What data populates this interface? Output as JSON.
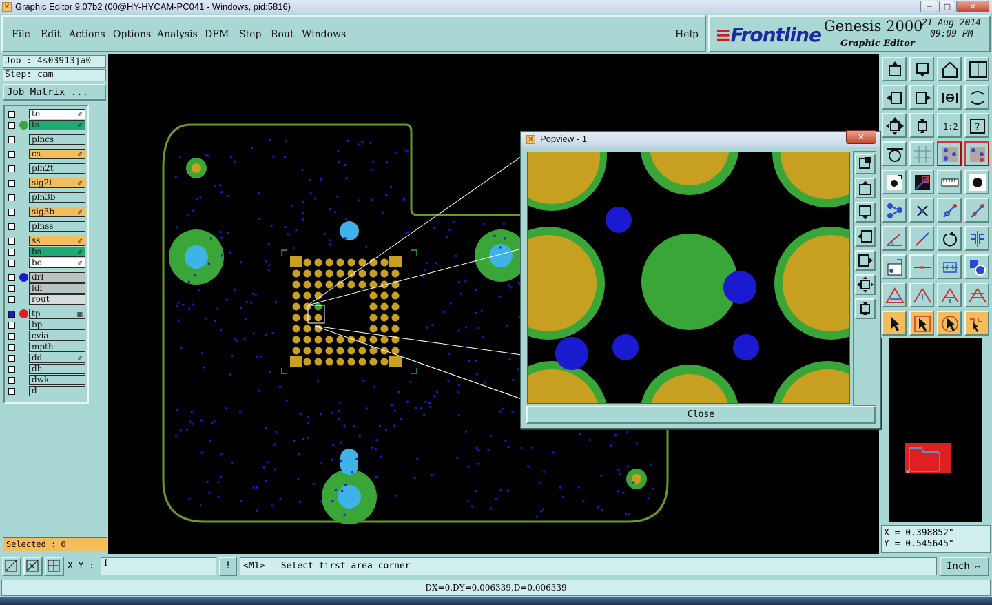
{
  "window": {
    "title": "Graphic Editor 9.07b2 (00@HY-HYCAM-PC041 - Windows, pid:5816)",
    "minimize": "─",
    "maximize": "□",
    "close": "✕"
  },
  "menu": {
    "items": [
      "File",
      "Edit",
      "Actions",
      "Options",
      "Analysis",
      "DFM",
      "Step",
      "Rout",
      "Windows"
    ],
    "help": "Help"
  },
  "logo": {
    "brand": "Frontline",
    "product": "Genesis 2000",
    "subtitle": "Graphic Editor",
    "date": "21 Aug 2014",
    "time": "09:09 PM"
  },
  "left": {
    "job": "Job : 4s03913ja0",
    "step": "Step: cam",
    "job_matrix": "Job Matrix ...",
    "selected": "Selected : 0"
  },
  "layers": [
    {
      "name": "to",
      "color": "#ffffff",
      "dot": "",
      "mark": "✐"
    },
    {
      "name": "ts",
      "color": "#1faa74",
      "dot": "#3aa637",
      "mark": "✐"
    },
    {
      "name": "plncs",
      "color": "#a9d8d4",
      "dot": "",
      "mark": ""
    },
    {
      "name": "cs",
      "color": "#f2bd5a",
      "dot": "",
      "mark": "✐"
    },
    {
      "name": "pln2t",
      "color": "#a9d8d4",
      "dot": "",
      "mark": ""
    },
    {
      "name": "sig2t",
      "color": "#f2bd5a",
      "dot": "",
      "mark": "✐"
    },
    {
      "name": "pln3b",
      "color": "#a9d8d4",
      "dot": "",
      "mark": ""
    },
    {
      "name": "sig3b",
      "color": "#f2bd5a",
      "dot": "",
      "mark": "✐"
    },
    {
      "name": "plnss",
      "color": "#a9d8d4",
      "dot": "",
      "mark": ""
    },
    {
      "name": "ss",
      "color": "#f2bd5a",
      "dot": "",
      "mark": "✐"
    },
    {
      "name": "bs",
      "color": "#1faa74",
      "dot": "",
      "mark": "✐"
    },
    {
      "name": "bo",
      "color": "#ffffff",
      "dot": "",
      "mark": "✐"
    },
    {
      "name": "drl",
      "color": "#b8c4c4",
      "dot": "#1a1ad0",
      "mark": ""
    },
    {
      "name": "ldi",
      "color": "#b8c4c4",
      "dot": "",
      "mark": ""
    },
    {
      "name": "rout",
      "color": "#d8dede",
      "dot": "",
      "mark": ""
    },
    {
      "name": "tp",
      "color": "#a9d8d4",
      "dot": "#e02020",
      "mark": "▦"
    },
    {
      "name": "bp",
      "color": "#a9d8d4",
      "dot": "",
      "mark": ""
    },
    {
      "name": "cvia",
      "color": "#a9d8d4",
      "dot": "",
      "mark": ""
    },
    {
      "name": "mpth",
      "color": "#a9d8d4",
      "dot": "",
      "mark": ""
    },
    {
      "name": "dd",
      "color": "#a9d8d4",
      "dot": "",
      "mark": "✐"
    },
    {
      "name": "dh",
      "color": "#a9d8d4",
      "dot": "",
      "mark": ""
    },
    {
      "name": "dwk",
      "color": "#a9d8d4",
      "dot": "",
      "mark": ""
    },
    {
      "name": "d",
      "color": "#a9d8d4",
      "dot": "",
      "mark": ""
    }
  ],
  "popview": {
    "title": "Popview - 1",
    "close_x": "✕",
    "close_button": "Close"
  },
  "coords": {
    "x": "X = 0.398852\"",
    "y": "Y = 0.545645\""
  },
  "bottom": {
    "xy_label": "X Y :",
    "xy_value": "",
    "bang": "!",
    "prompt": "<M1> - Select first area corner",
    "unit": "Inch",
    "status": "DX=0,DY=0.006339,D=0.006339"
  },
  "colors": {
    "bg": "#a9d8d4",
    "board_outline": "#6a9a1e",
    "pad_green": "#3aa637",
    "pad_gold": "#c8a021",
    "hole_cyan": "#3fb3e8",
    "via_blue": "#1a1ad0"
  }
}
